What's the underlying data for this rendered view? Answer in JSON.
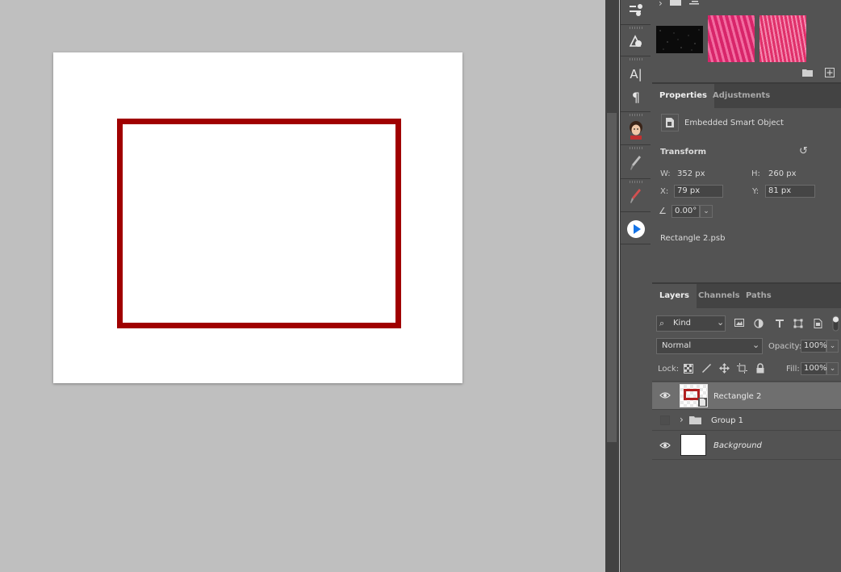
{
  "colors": {
    "app_bg": "#bfbfbf",
    "panel_bg": "#535353",
    "tab_bar_bg": "#434343",
    "rectangle_stroke": "#a00000",
    "document_fill": "#ffffff"
  },
  "icons": {
    "chevron_right": "›",
    "folder": "▆",
    "folder_open": "▬",
    "new_group": "▆",
    "new_layer": "⊞",
    "type_tool": "A|",
    "paragraph": "¶",
    "eye": "◉",
    "search": "⌕",
    "dropdown": "⌄",
    "reset": "↺",
    "angle": "∠",
    "smart_object": "◨",
    "lock": "🔒"
  },
  "swatches": {
    "colors": [
      "#0b0b0b",
      "#e0306a",
      "#e83d7a"
    ]
  },
  "properties_panel": {
    "tabs": [
      {
        "label": "Properties",
        "active": true
      },
      {
        "label": "Adjustments",
        "active": false
      }
    ],
    "object_type": "Embedded Smart Object",
    "section_title": "Transform",
    "w_label": "W:",
    "w_value": "352 px",
    "h_label": "H:",
    "h_value": "260 px",
    "x_label": "X:",
    "x_value": "79 px",
    "y_label": "Y:",
    "y_value": "81 px",
    "angle_value": "0.00°",
    "file_name": "Rectangle 2.psb"
  },
  "layers_panel": {
    "tabs": [
      {
        "label": "Layers",
        "active": true
      },
      {
        "label": "Channels",
        "active": false
      },
      {
        "label": "Paths",
        "active": false
      }
    ],
    "filter_kind": "Kind",
    "blend_mode": "Normal",
    "opacity_label": "Opacity:",
    "opacity_value": "100%",
    "lock_label": "Lock:",
    "fill_label": "Fill:",
    "fill_value": "100%",
    "layers": [
      {
        "name": "Rectangle 2",
        "visible": true,
        "selected": true
      },
      {
        "name": "Group 1",
        "visible": false,
        "selected": false
      },
      {
        "name": "Background",
        "visible": true,
        "selected": false
      }
    ]
  }
}
